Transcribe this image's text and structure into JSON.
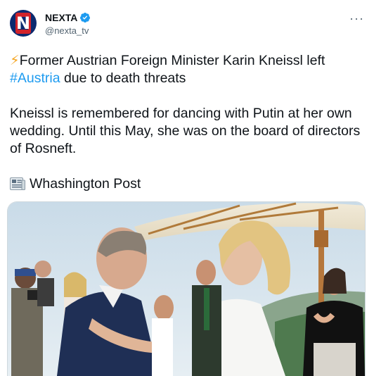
{
  "account": {
    "display_name": "NEXTA",
    "handle": "@nexta_tv",
    "verified": true,
    "avatar_icon": "nexta-logo-icon"
  },
  "menu": {
    "more_label": "···"
  },
  "tweet": {
    "headline_prefix": "⚡",
    "headline_part1": "Former Austrian Foreign Minister Karin Kneissl left ",
    "hashtag": "#Austria",
    "headline_part2": " due to death threats",
    "paragraph": "Kneissl is remembered for dancing with Putin at her own wedding. Until this May, she was on the board of directors of Rosneft.",
    "source_label": "Whashington Post"
  },
  "colors": {
    "text": "#0f1419",
    "secondary": "#536471",
    "link": "#1d9bf0",
    "verified": "#1d9bf0"
  }
}
